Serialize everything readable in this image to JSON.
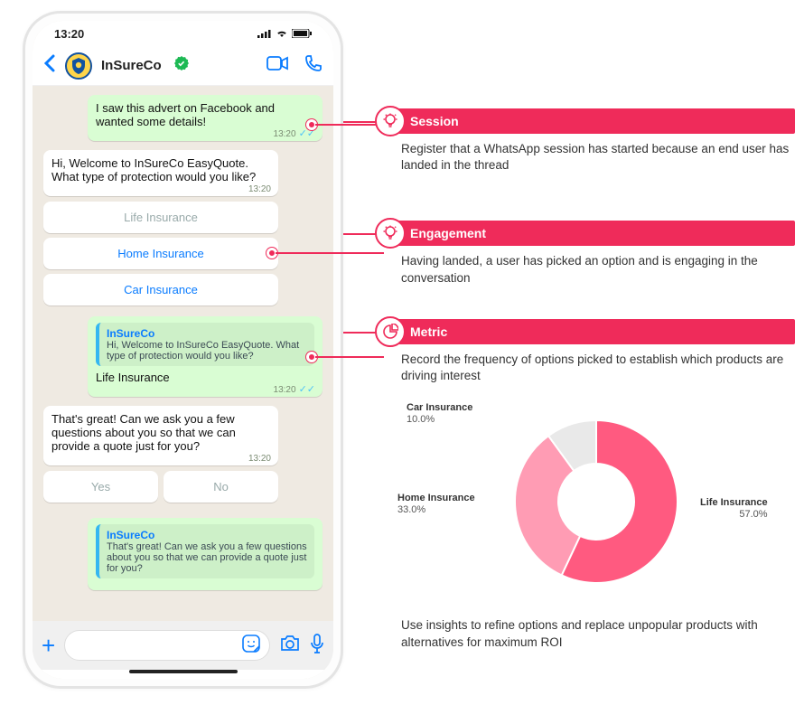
{
  "phone": {
    "time": "13:20",
    "contact": "InSureCo",
    "msg_out1": "I saw this advert on Facebook and wanted some details!",
    "ts1": "13:20",
    "msg_in1": "Hi, Welcome to InSureCo EasyQuote. What type of protection would you like?",
    "ts2": "13:20",
    "opt1": "Life Insurance",
    "opt2": "Home Insurance",
    "opt3": "Car Insurance",
    "quote1_title": "InSureCo",
    "quote1_body": "Hi, Welcome to InSureCo EasyQuote. What type of protection would you like?",
    "reply_text": "Life Insurance",
    "ts3": "13:20",
    "msg_in2": "That's great! Can we ask you a few questions about you so that we can provide a quote just for you?",
    "ts4": "13:20",
    "yes": "Yes",
    "no": "No",
    "quote2_title": "InSureCo",
    "quote2_body": "That's great! Can we ask you a few questions about you so that we can provide a quote just for you?"
  },
  "callouts": {
    "session": {
      "title": "Session",
      "body": "Register that a WhatsApp session has started because an end user has landed in the thread"
    },
    "engagement": {
      "title": "Engagement",
      "body": "Having landed, a user has picked an option and is engaging in the conversation"
    },
    "metric": {
      "title": "Metric",
      "body": "Record the frequency of options picked to establish which products are driving interest",
      "footer": "Use insights to refine options and replace unpopular products with alternatives for maximum ROI"
    }
  },
  "chart_data": {
    "type": "pie",
    "title": "",
    "series": [
      {
        "name": "Life Insurance",
        "value": 57.0,
        "color": "#ff5a80"
      },
      {
        "name": "Home Insurance",
        "value": 33.0,
        "color": "#ff9cb4"
      },
      {
        "name": "Car Insurance",
        "value": 10.0,
        "color": "#e9e9e9"
      }
    ],
    "labels": {
      "life": "Life Insurance",
      "life_pct": "57.0%",
      "home": "Home Insurance",
      "home_pct": "33.0%",
      "car": "Car Insurance",
      "car_pct": "10.0%"
    }
  }
}
